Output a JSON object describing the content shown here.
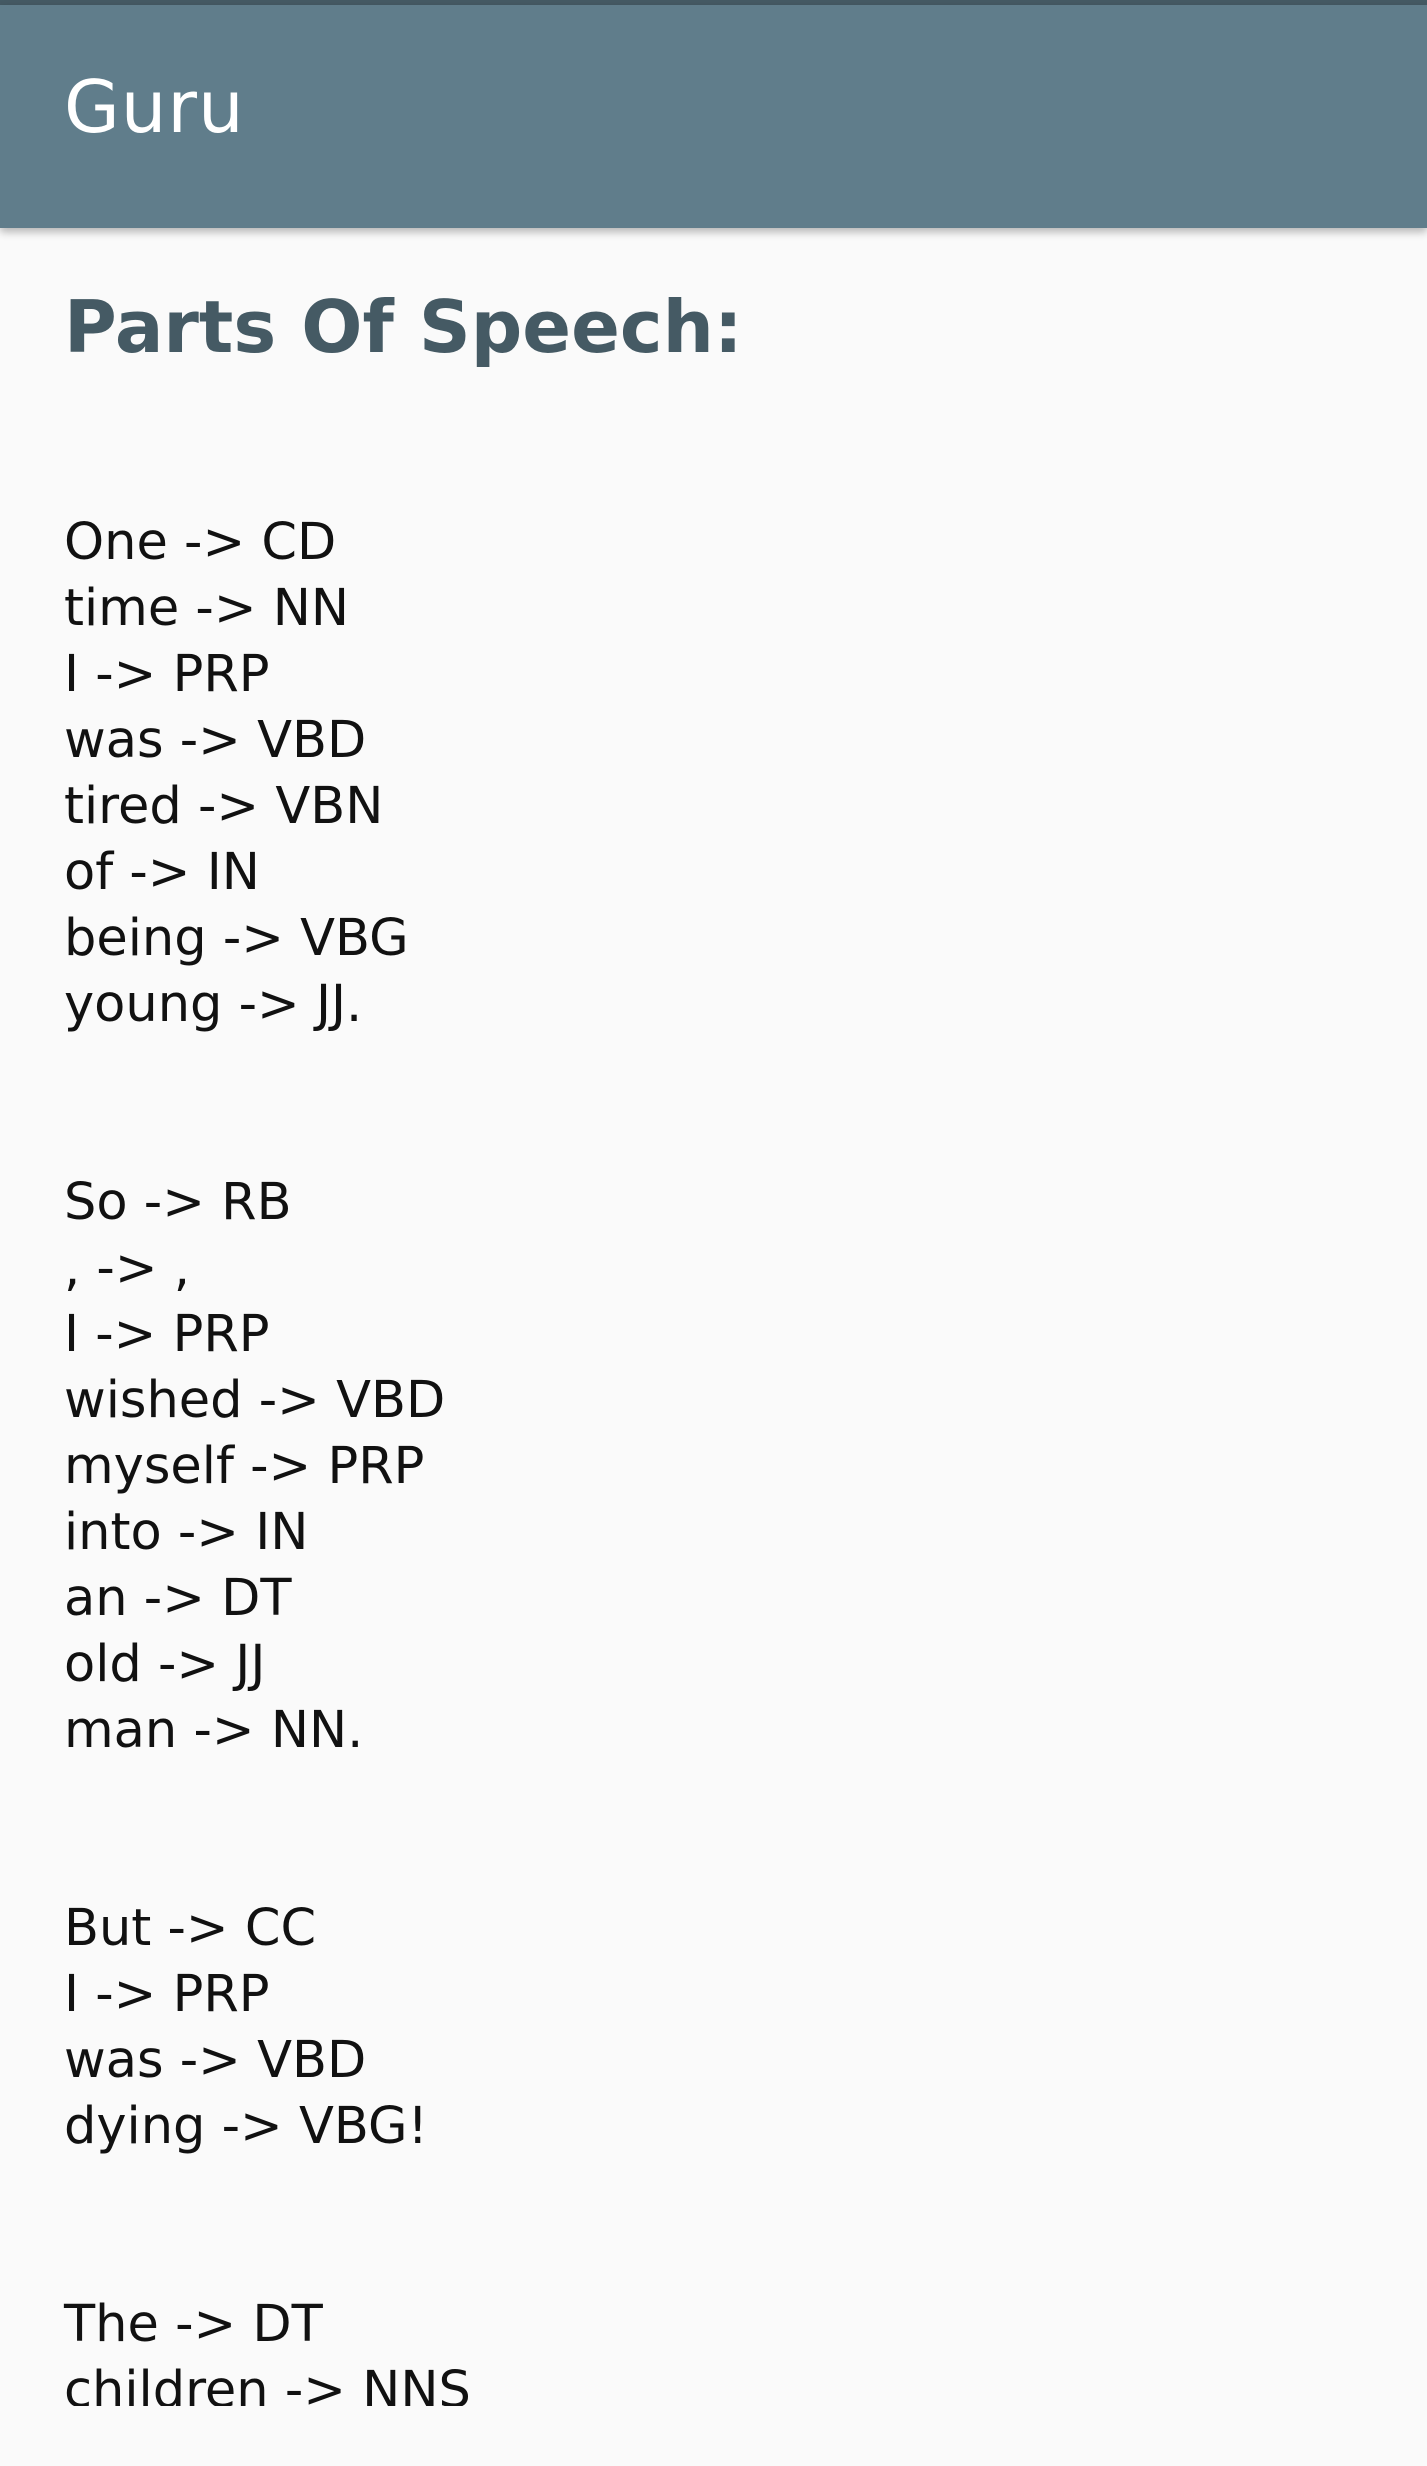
{
  "app_bar": {
    "title": "Guru"
  },
  "main": {
    "heading": "Parts Of Speech:",
    "sentences": [
      [
        "One -> CD",
        "time -> NN",
        "I -> PRP",
        "was -> VBD",
        "tired -> VBN",
        "of -> IN",
        "being -> VBG",
        "young -> JJ."
      ],
      [
        "So -> RB",
        ", -> ,",
        "I -> PRP",
        "wished -> VBD",
        "myself -> PRP",
        "into -> IN",
        "an -> DT",
        "old -> JJ",
        "man -> NN."
      ],
      [
        "But -> CC",
        "I -> PRP",
        "was -> VBD",
        "dying -> VBG!"
      ],
      [
        "The -> DT",
        "children -> NNS"
      ]
    ]
  },
  "colors": {
    "app_bar": "#607d8b",
    "status_bar": "#455a64",
    "heading": "#455a64",
    "background": "#fafafa",
    "text": "#111111"
  }
}
